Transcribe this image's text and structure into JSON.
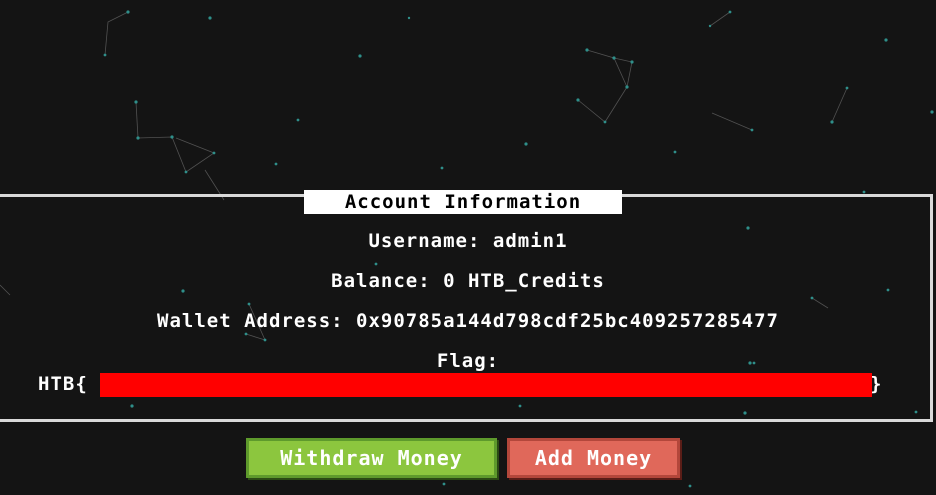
{
  "account": {
    "title": "Account Information",
    "username_label": "Username: admin1",
    "balance_label": "Balance: 0 HTB_Credits",
    "wallet_label": "Wallet Address: 0x90785a144d798cdf25bc409257285477",
    "flag_label": "Flag:",
    "flag_prefix": "HTB{",
    "flag_suffix": "}"
  },
  "actions": {
    "withdraw_label": "Withdraw Money",
    "add_label": "Add Money"
  },
  "colors": {
    "background": "#141414",
    "panel_border": "#d9d9d9",
    "redaction": "#ff0000",
    "withdraw_button": "#8cc63e",
    "add_button": "#e0685a",
    "particles": "#2f8f8a"
  }
}
